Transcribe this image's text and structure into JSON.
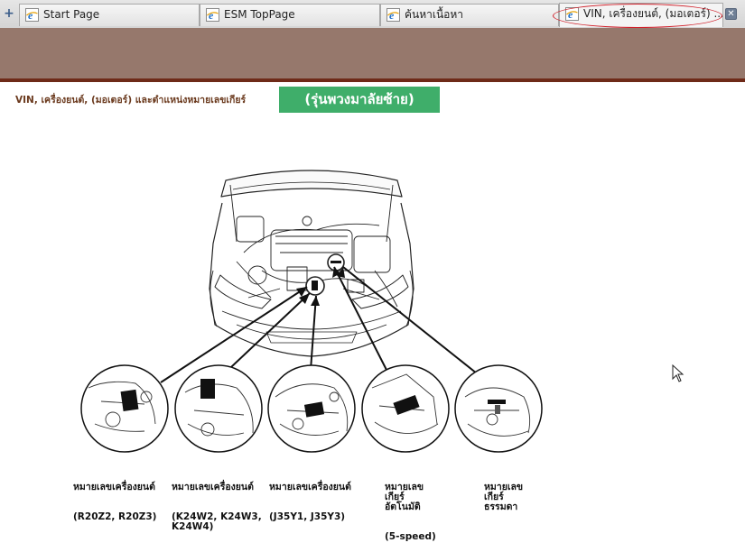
{
  "tabs": [
    {
      "label": "Start Page",
      "active": false
    },
    {
      "label": "ESM TopPage",
      "active": false
    },
    {
      "label": "ค้นหาเนื้อหา",
      "active": false
    },
    {
      "label": "VIN, เครื่องยนต์, (มอเตอร์) ...",
      "active": true
    }
  ],
  "icons": {
    "new_tab": "plus-icon",
    "tab": "ie-page-icon",
    "close": "close-icon",
    "cursor": "mouse-pointer-icon"
  },
  "colors": {
    "banner": "#96786c",
    "banner_line": "#6e2a18",
    "badge": "#3fae6a",
    "heading": "#6b3a1e",
    "highlight": "#d0202a"
  },
  "page": {
    "heading": "VIN, เครื่องยนต์, (มอเตอร์) และตำแหน่งหมายเลขเกียร์",
    "variant_badge": "(รุ่นพวงมาลัยซ้าย)"
  },
  "callouts": [
    {
      "title": "หมายเลขเครื่องยนต์",
      "detail": "(R20Z2, R20Z3)"
    },
    {
      "title": "หมายเลขเครื่องยนต์",
      "detail": "(K24W2, K24W3,\nK24W4)"
    },
    {
      "title": "หมายเลขเครื่องยนต์",
      "detail": "(J35Y1, J35Y3)"
    },
    {
      "title": "หมายเลข\nเกียร์\nอัตโนมัติ",
      "detail": "(5-speed)"
    },
    {
      "title": "หมายเลข\nเกียร์\nธรรมดา",
      "detail": ""
    }
  ]
}
